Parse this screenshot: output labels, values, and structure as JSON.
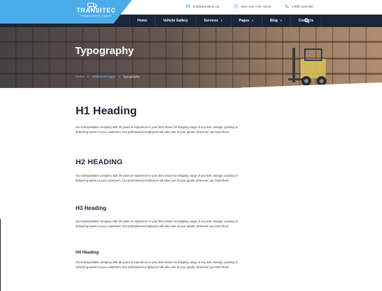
{
  "brand": {
    "name": "TRANSITEC",
    "tagline": "Transportation & Logistics",
    "accent": "#4cacea",
    "dark": "#1a2538"
  },
  "contacts": [
    {
      "icon": "mail-icon",
      "text": "info@demolink.org"
    },
    {
      "icon": "clock-icon",
      "text": "Mon–Sat: 7:00–19:00"
    },
    {
      "icon": "phone-icon",
      "text": "1-800-1234-567"
    }
  ],
  "nav": {
    "items": [
      {
        "label": "Home",
        "dropdown": false
      },
      {
        "label": "Vehicle Gallery",
        "dropdown": false
      },
      {
        "label": "Services",
        "dropdown": true
      },
      {
        "label": "Pages",
        "dropdown": true
      },
      {
        "label": "Blog",
        "dropdown": true
      },
      {
        "label": "Contacts",
        "dropdown": false
      }
    ],
    "search_icon": "search-icon"
  },
  "hero": {
    "title": "Typography",
    "breadcrumb": {
      "home": "Home",
      "parent": "Additional Pages",
      "current": "Typography",
      "separator": "»"
    }
  },
  "content": {
    "paragraph": "Our transportation company with 30 years of experience is your best choice for shipping cargo of any size, storage, packing or delivering wares to your customers. Our professional employees will take care of your goods, whenever you send them.",
    "h1": "H1 Heading",
    "h2": "H2 HEADING",
    "h3": "H3 Heading",
    "h4": "H4 Heading"
  }
}
